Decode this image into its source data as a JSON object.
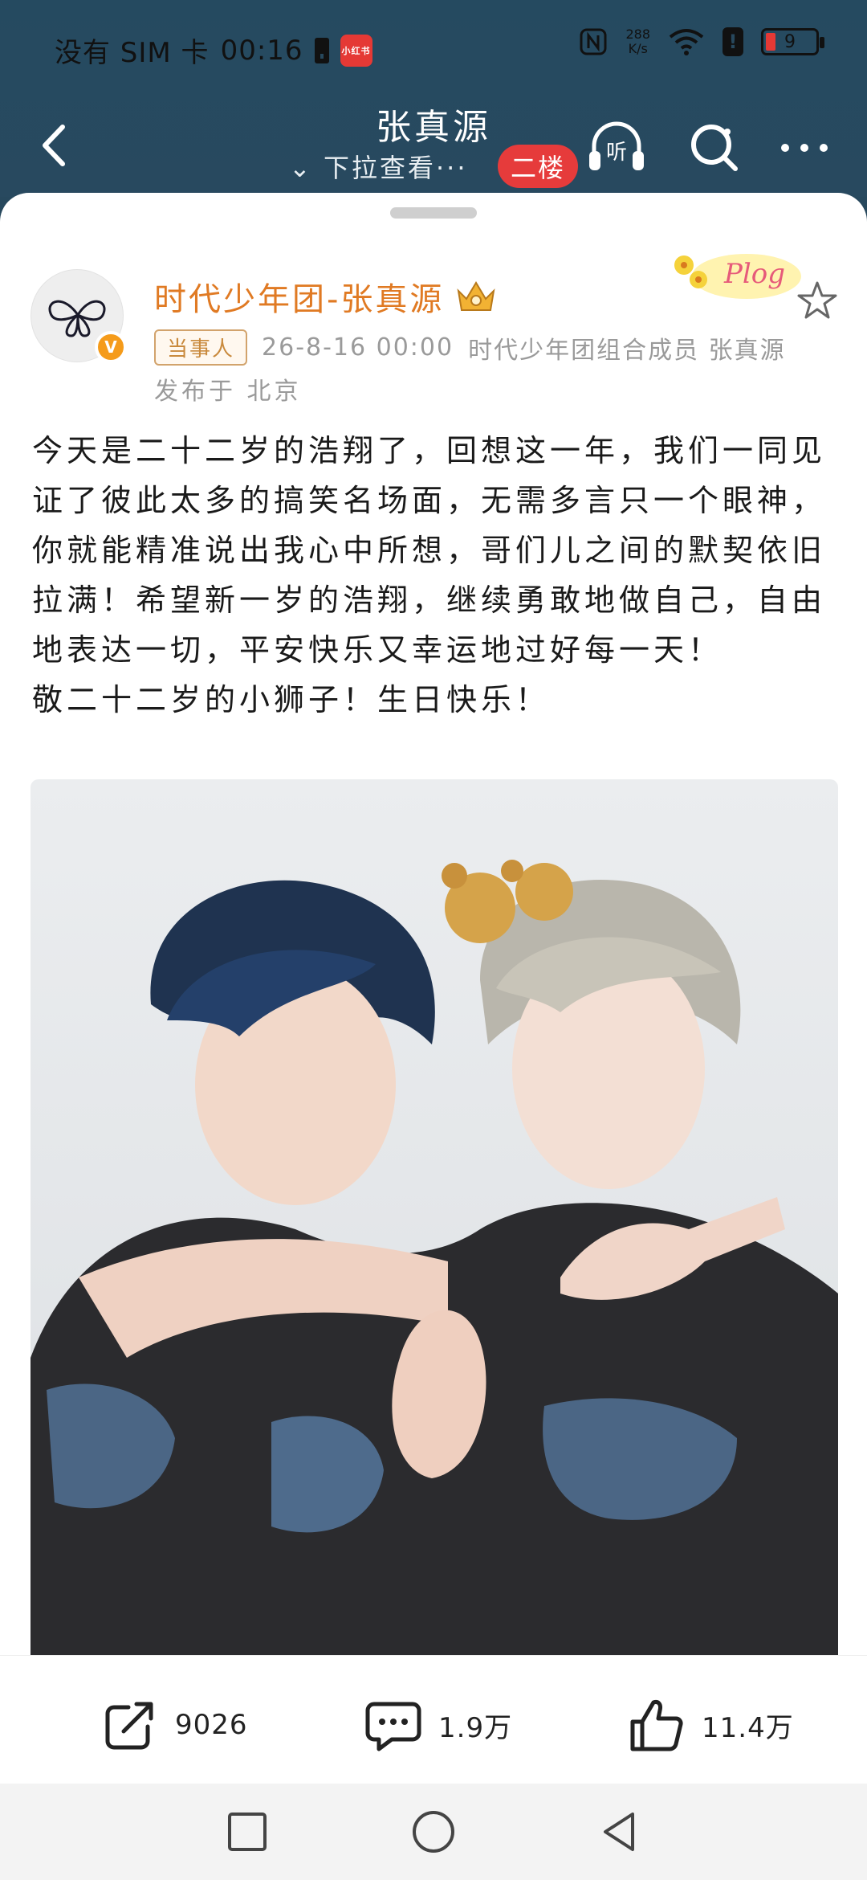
{
  "status_bar": {
    "carrier": "没有 SIM 卡",
    "time": "00:16",
    "app_badge": "小红书",
    "net_speed_value": "288",
    "net_speed_unit": "K/s",
    "battery": "9"
  },
  "nav": {
    "title": "张真源",
    "subtitle": "下拉查看···",
    "floor_badge": "二楼",
    "listen_label": "听"
  },
  "post": {
    "author": "时代少年团-张真源",
    "verified_badge": "V",
    "tag": "当事人",
    "date": "26-8-16 00:00",
    "author_desc": "时代少年团组合成员 张真源",
    "location": "发布于 北京",
    "plog_label": "Plog",
    "body": "今天是二十二岁的浩翔了，回想这一年，我们一同见证了彼此太多的搞笑名场面，无需多言只一个眼神，你就能精准说出我心中所想，哥们儿之间的默契依旧拉满！希望新一岁的浩翔，继续勇敢地做自己，自由地表达一切，平安快乐又幸运地过好每一天！",
    "body_line2": "敬二十二岁的小狮子！生日快乐！"
  },
  "actions": {
    "share_count": "9026",
    "comment_count": "1.9万",
    "like_count": "11.4万"
  },
  "colors": {
    "header_bg": "#27485d",
    "author_name": "#e07a23",
    "floor_badge": "#e63b3b",
    "verify_badge": "#f59b1a"
  },
  "icons": {
    "back": "chevron-left-icon",
    "listen": "headphones-icon",
    "search": "search-icon",
    "more": "more-dots-icon",
    "favorite": "star-icon",
    "share": "share-icon",
    "comment": "comment-icon",
    "like": "thumbs-up-icon"
  }
}
